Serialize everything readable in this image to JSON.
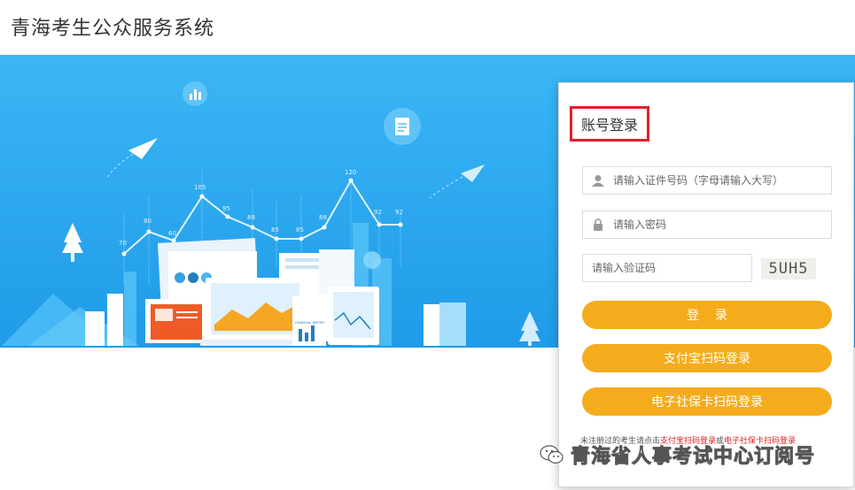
{
  "header": {
    "title": "青海考生公众服务系统"
  },
  "banner": {
    "chart_labels": [
      "70",
      "80",
      "60",
      "105",
      "95",
      "88",
      "85",
      "85",
      "88",
      "120",
      "92",
      "92"
    ],
    "report_title": "FINANCIAL REPORT"
  },
  "login": {
    "tab_label": "账号登录",
    "id_placeholder": "请输入证件号码（字母请输入大写）",
    "password_placeholder": "请输入密码",
    "captcha_placeholder": "请输入验证码",
    "captcha_text": "5UH5",
    "login_button": "登录",
    "alipay_button": "支付宝扫码登录",
    "social_card_button": "电子社保卡扫码登录",
    "tip_prefix": "未注册过的考生请点击",
    "tip_link1": "支付宝扫码登录",
    "tip_mid": "或",
    "tip_link2": "电子社保卡扫码登录"
  },
  "watermark": {
    "text": "青海省人事考试中心订阅号"
  },
  "colors": {
    "banner": "#2ea8f0",
    "button": "#f5ac1c",
    "highlight": "#e0202a"
  },
  "icons": [
    "user-icon",
    "lock-icon",
    "wechat-icon",
    "paper-plane-icon",
    "chart-icon",
    "document-icon"
  ]
}
